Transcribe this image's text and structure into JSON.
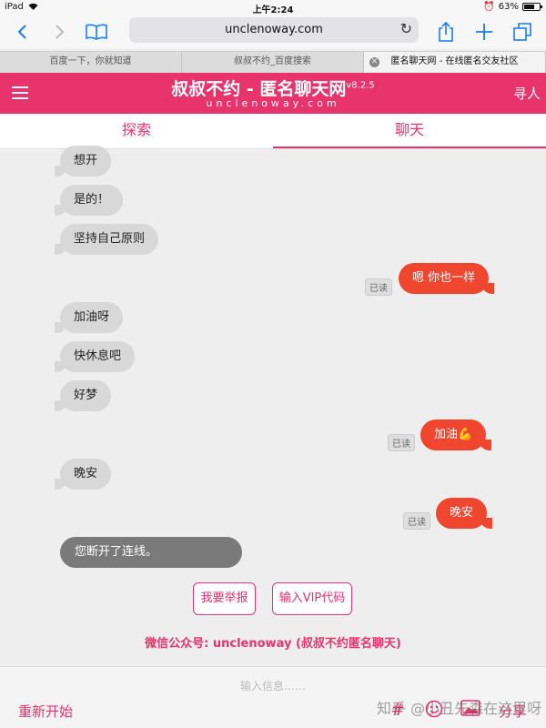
{
  "status_bar": {
    "device": "iPad",
    "time": "上午2:24",
    "battery": "63%"
  },
  "browser": {
    "url": "unclenoway.com",
    "tabs": [
      {
        "label": "百度一下，你就知道"
      },
      {
        "label": "叔叔不约_百度搜索"
      },
      {
        "label": "匿名聊天网 - 在线匿名交友社区"
      }
    ]
  },
  "app": {
    "title": "叔叔不约 - 匿名聊天网",
    "version": "v8.2.5",
    "subtitle": "unclenoway.com",
    "find_label": "寻人",
    "nav": {
      "explore": "探索",
      "chat": "聊天"
    }
  },
  "chat": {
    "messages": [
      {
        "dir": "in",
        "text": "想开"
      },
      {
        "dir": "in",
        "text": "是的！"
      },
      {
        "dir": "in",
        "text": "坚持自己原则"
      },
      {
        "dir": "out",
        "text": "嗯 你也一样",
        "read": "已读"
      },
      {
        "dir": "in",
        "text": "加油呀"
      },
      {
        "dir": "in",
        "text": "快休息吧"
      },
      {
        "dir": "in",
        "text": "好梦"
      },
      {
        "dir": "out",
        "text": "加油💪",
        "read": "已读"
      },
      {
        "dir": "in",
        "text": "晚安"
      },
      {
        "dir": "out",
        "text": "晚安",
        "read": "已读"
      }
    ],
    "disconnect_notice": "您断开了连线。",
    "report_label": "我要举报",
    "vip_label": "输入VIP代码",
    "wechat_text": "微信公众号: unclenoway (叔叔不约匿名聊天)"
  },
  "bottom": {
    "input_placeholder": "输入信息……",
    "restart_label": "重新开始",
    "share_label": "分享",
    "watermark": "知乎 @小丑先森在这里呀"
  },
  "colors": {
    "brand": "#e8336c",
    "outgoing": "#f0452f",
    "incoming": "#d8d8d8"
  }
}
